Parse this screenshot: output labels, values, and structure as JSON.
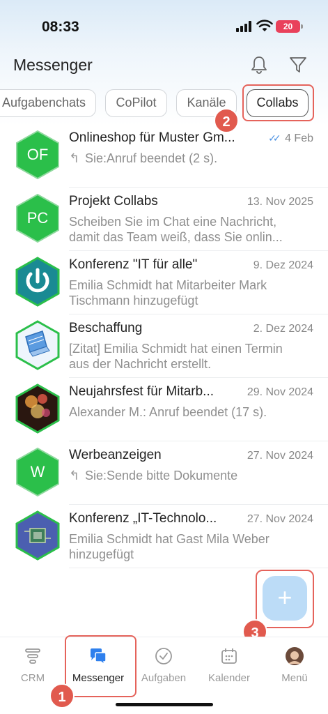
{
  "status_bar": {
    "time": "08:33",
    "battery": "20"
  },
  "header": {
    "title": "Messenger"
  },
  "tabs": [
    {
      "label": "Aufgabenchats"
    },
    {
      "label": "CoPilot"
    },
    {
      "label": "Kanäle"
    },
    {
      "label": "Collabs",
      "active": true
    }
  ],
  "callouts": [
    "1",
    "2",
    "3"
  ],
  "chats": [
    {
      "initials": "OF",
      "title": "Onlineshop für Muster Gm...",
      "date": "4 Feb",
      "read": true,
      "reply": true,
      "preview": "Sie:Anruf beendet (2 s)."
    },
    {
      "initials": "PC",
      "title": "Projekt Collabs",
      "date": "13. Nov 2025",
      "reply": false,
      "preview": "Scheiben Sie im Chat eine Nachricht, damit das Team weiß, dass Sie onlin..."
    },
    {
      "initials": "",
      "title": "Konferenz \"IT für alle\"",
      "date": "9. Dez 2024",
      "reply": false,
      "preview": "Emilia Schmidt hat Mitarbeiter Mark Tischmann hinzugefügt"
    },
    {
      "initials": "",
      "title": "Beschaffung",
      "date": "2. Dez 2024",
      "reply": false,
      "preview": "[Zitat]  Emilia Schmidt hat einen Termin aus der Nachricht erstellt."
    },
    {
      "initials": "",
      "title": "Neujahrsfest für Mitarb...",
      "date": "29. Nov 2024",
      "reply": false,
      "preview": "Alexander M.: Anruf beendet (17 s)."
    },
    {
      "initials": "W",
      "title": "Werbeanzeigen",
      "date": "27. Nov 2024",
      "reply": true,
      "preview": "Sie:Sende bitte Dokumente"
    },
    {
      "initials": "",
      "title": "Konferenz „IT-Technolo...",
      "date": "27. Nov 2024",
      "reply": false,
      "preview": "Emilia Schmidt hat Gast Mila Weber hinzugefügt"
    }
  ],
  "fab": {
    "label": "+"
  },
  "bottom_nav": [
    {
      "label": "CRM",
      "icon": "crm-icon"
    },
    {
      "label": "Messenger",
      "icon": "messenger-icon",
      "active": true
    },
    {
      "label": "Aufgaben",
      "icon": "tasks-icon"
    },
    {
      "label": "Kalender",
      "icon": "calendar-icon"
    },
    {
      "label": "Menü",
      "icon": "profile-avatar"
    }
  ],
  "colors": {
    "accent": "#2f80ed",
    "avatar_green": "#2bbf4a",
    "callout": "#e15a4e"
  }
}
